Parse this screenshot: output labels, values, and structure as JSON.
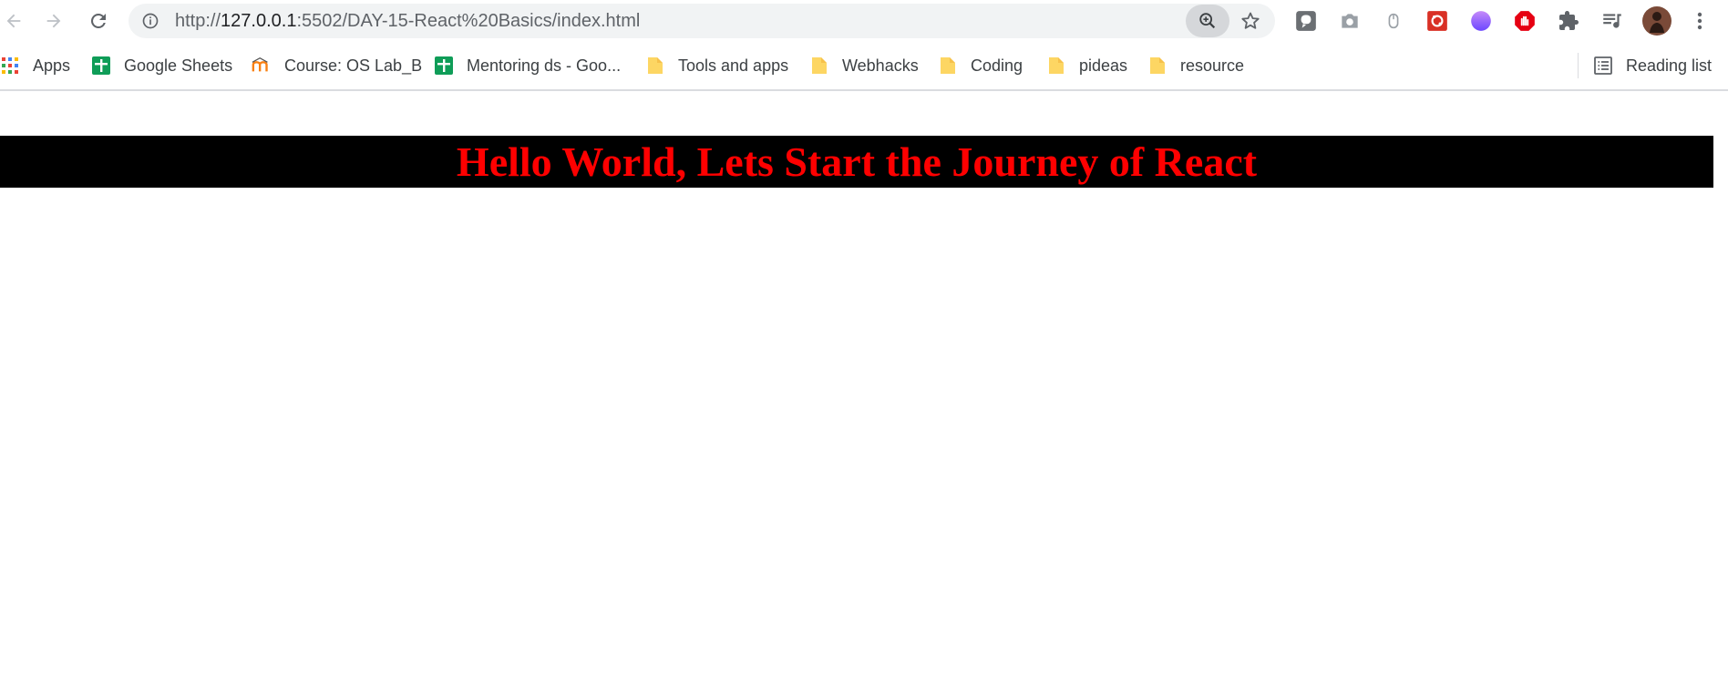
{
  "browser": {
    "url_prefix": "http://",
    "url_host": "127.0.0.1",
    "url_rest": ":5502/DAY-15-React%20Basics/index.html",
    "icons": {
      "back": "back-arrow-icon",
      "forward": "forward-arrow-icon",
      "reload": "reload-icon",
      "info": "info-icon",
      "zoom": "zoom-in-icon",
      "star": "star-icon",
      "menu": "kebab-menu-icon"
    },
    "extensions": [
      "extension-icon-1",
      "camera-icon",
      "mouse-icon",
      "extension-icon-red",
      "extension-icon-gradient",
      "stop-hand-icon",
      "puzzle-icon",
      "queue-music-icon",
      "profile-avatar"
    ]
  },
  "bookmarks": {
    "items": [
      {
        "label": "Apps",
        "icon": "apps-grid-icon"
      },
      {
        "label": "Google Sheets",
        "icon": "sheets-icon"
      },
      {
        "label": "Course: OS Lab_B",
        "icon": "moodle-icon"
      },
      {
        "label": "Mentoring ds - Goo...",
        "icon": "sheets-icon"
      },
      {
        "label": "Tools and apps",
        "icon": "folder-icon"
      },
      {
        "label": "Webhacks",
        "icon": "folder-icon"
      },
      {
        "label": "Coding",
        "icon": "folder-icon"
      },
      {
        "label": "pideas",
        "icon": "folder-icon"
      },
      {
        "label": "resource",
        "icon": "folder-icon"
      }
    ],
    "reading_list_label": "Reading list"
  },
  "page": {
    "heading": "Hello World, Lets Start the Journey of React",
    "heading_color": "#ff0000",
    "heading_background": "#000000"
  }
}
